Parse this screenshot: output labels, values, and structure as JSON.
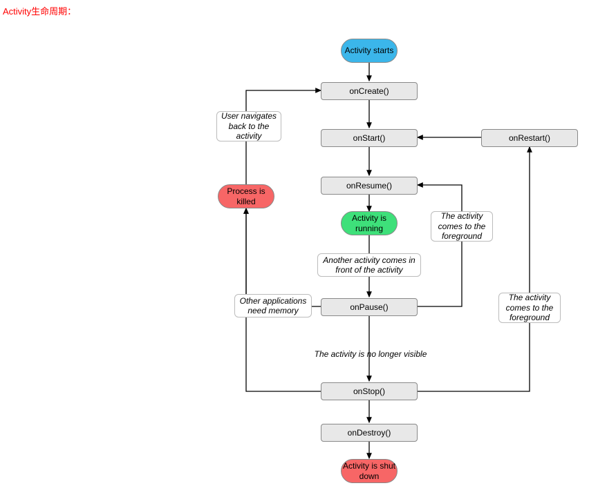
{
  "title": "Activity生命周期：",
  "nodes": {
    "start": "Activity\nstarts",
    "onCreate": "onCreate()",
    "onStart": "onStart()",
    "onRestart": "onRestart()",
    "onResume": "onResume()",
    "running": "Activity is\nrunning",
    "onPause": "onPause()",
    "onStop": "onStop()",
    "onDestroy": "onDestroy()",
    "shutDown": "Activity is\nshut down",
    "killed": "Process is\nkilled"
  },
  "labels": {
    "userNavigates": "User navigates\nback to the\nactivity",
    "foreground1": "The activity\ncomes to the\nforeground",
    "foreground2": "The activity\ncomes to the\nforeground",
    "anotherActivity": "Another activity comes\nin front of the activity",
    "otherApps": "Other applications\nneed memory",
    "noLongerVisible": "The activity is no longer visible"
  }
}
